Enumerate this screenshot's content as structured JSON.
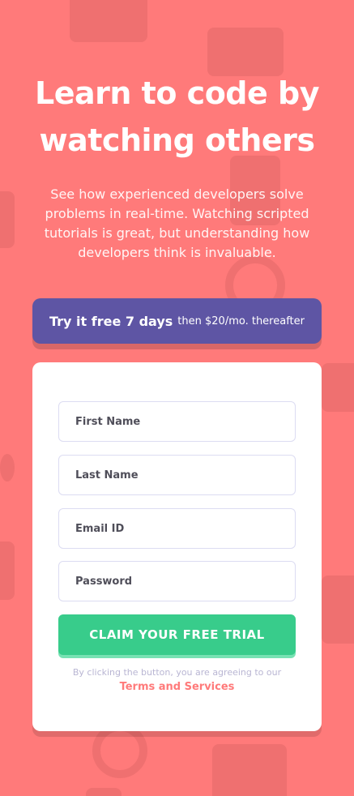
{
  "hero": {
    "title_line_1": "Learn to code by",
    "title_line_2": "watching others",
    "subtitle": "See how experienced developers solve problems in real-time. Watching scripted tutorials is great, but understanding how developers think is invaluable."
  },
  "promo": {
    "strong_text": "Try it free 7 days",
    "rest_text": "then $20/mo. thereafter"
  },
  "form": {
    "first_name_placeholder": "First Name",
    "last_name_placeholder": "Last Name",
    "email_placeholder": "Email ID",
    "password_placeholder": "Password",
    "cta_label": "CLAIM YOUR FREE TRIAL",
    "terms_prefix": "By clicking the button, you are agreeing to our",
    "terms_link": "Terms and Services"
  },
  "colors": {
    "background": "#ff7a7a",
    "promo": "#5e55a4",
    "cta": "#38cc8b",
    "link": "#ff7a7a"
  }
}
